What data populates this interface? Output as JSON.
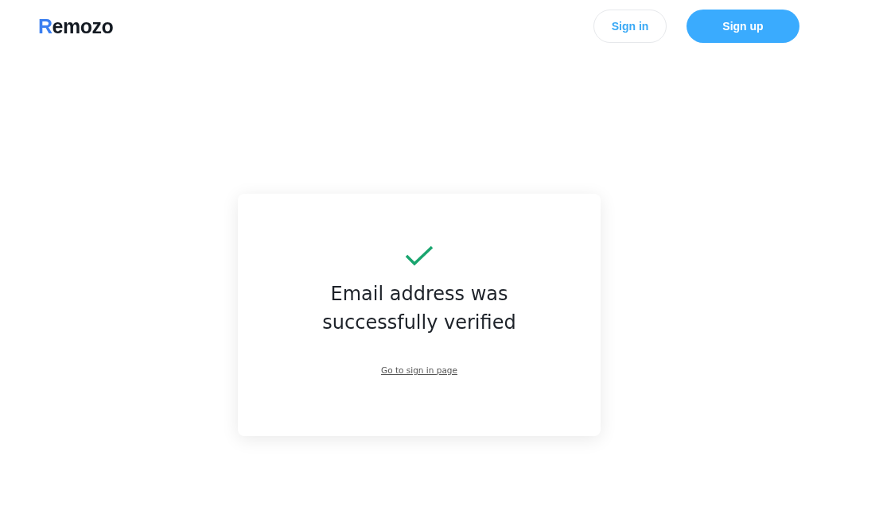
{
  "header": {
    "logo": {
      "first_letter": "R",
      "rest": "emozo"
    },
    "buttons": [
      {
        "label": "Sign in",
        "kind": "outline"
      },
      {
        "label": "Sign up",
        "kind": "filled"
      }
    ]
  },
  "card": {
    "title": "Email address was successfully verified",
    "link": "Go to sign in page"
  }
}
